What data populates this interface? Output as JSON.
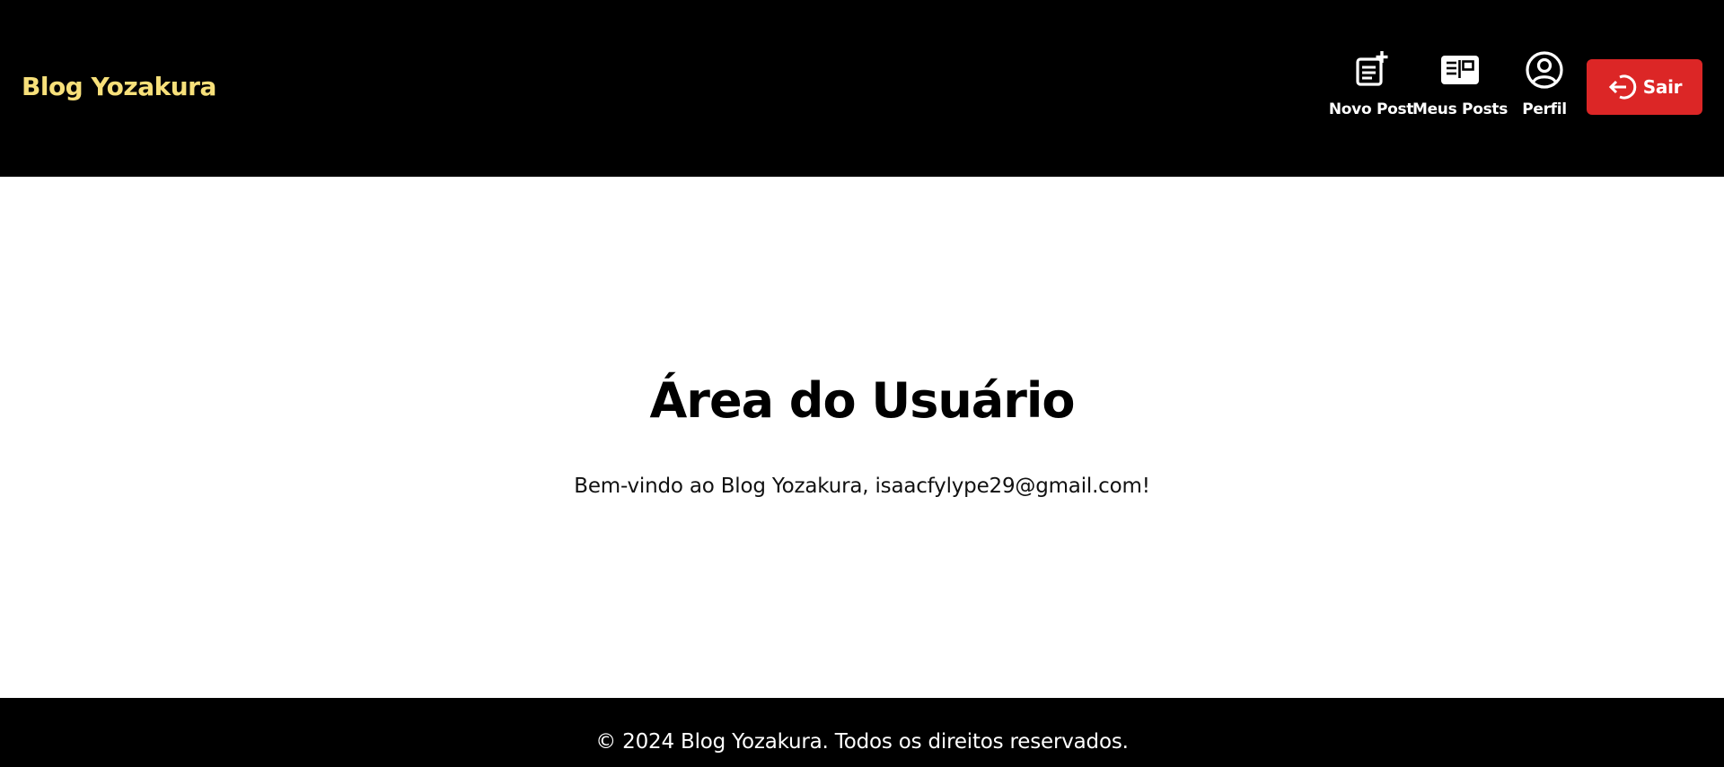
{
  "header": {
    "brand": "Blog Yozakura",
    "nav": [
      {
        "label": "Novo Post",
        "icon": "note-add-icon"
      },
      {
        "label": "Meus Posts",
        "icon": "newspaper-icon"
      },
      {
        "label": "Perfil",
        "icon": "user-circle-icon"
      }
    ],
    "logout": {
      "label": "Sair",
      "icon": "logout-arrow-icon"
    }
  },
  "main": {
    "title": "Área do Usuário",
    "welcome": "Bem-vindo ao Blog Yozakura, isaacfylype29@gmail.com!"
  },
  "footer": {
    "text": "© 2024 Blog Yozakura. Todos os direitos reservados."
  },
  "colors": {
    "header_bg": "#000000",
    "brand": "#f7e07a",
    "logout_bg": "#dc2626",
    "footer_bg": "#000000"
  }
}
